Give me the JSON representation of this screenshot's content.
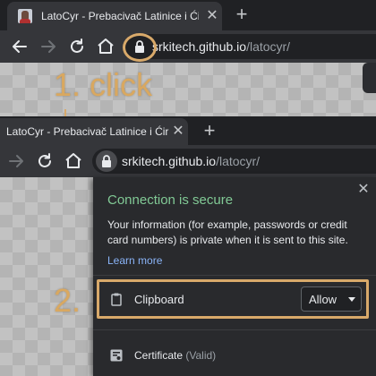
{
  "top_window": {
    "tab": {
      "title": "LatoCyr - Prebacivač Latinice i Ćirilice",
      "close": "✕"
    },
    "new_tab": "+",
    "address_bar": {
      "host": "srkitech.github.io",
      "path": "/latocyr/"
    }
  },
  "annotations": {
    "step1": "1. click",
    "step2": "2.",
    "highlight_color": "#d8a96a"
  },
  "second_window": {
    "tab": {
      "title": "LatoCyr - Prebacivač Latinice i Ćirilice",
      "close": "✕"
    },
    "new_tab": "+",
    "address_bar": {
      "host": "srkitech.github.io",
      "path": "/latocyr/"
    }
  },
  "site_info_popup": {
    "close": "✕",
    "title": "Connection is secure",
    "description": "Your information (for example, passwords or credit card numbers) is private when it is sent to this site.",
    "learn_more": "Learn more",
    "permission": {
      "label": "Clipboard",
      "value": "Allow",
      "icon": "clipboard-icon"
    },
    "certificate": {
      "label": "Certificate",
      "status": "(Valid)",
      "icon": "certificate-icon"
    },
    "colors": {
      "secure": "#81c995",
      "link": "#8ab4f8"
    }
  }
}
